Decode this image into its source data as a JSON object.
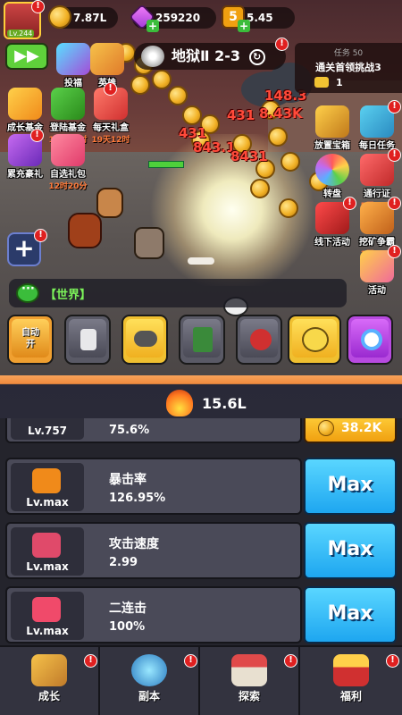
{
  "hud": {
    "player_level": "Lv.244",
    "gold": "7.87L",
    "gems": "259220",
    "energy": "5.45",
    "energy_icon": "5"
  },
  "stage": {
    "title": "地狱Ⅱ 2-3",
    "cycle_icon": "cycle-icon"
  },
  "left_menu": {
    "top_row": [
      {
        "label": "投福"
      },
      {
        "label": "英雄"
      }
    ],
    "row2": [
      {
        "label": "成长基金",
        "sub": ""
      },
      {
        "label": "登陆基金",
        "sub": "19天12时"
      },
      {
        "label": "每天礼盒",
        "sub": "19天12时"
      }
    ],
    "row3": [
      {
        "label": "累充豪礼",
        "sub": ""
      },
      {
        "label": "自选礼包",
        "sub": "12时20分"
      }
    ]
  },
  "quest": {
    "header": "任务 50",
    "title": "通关首领挑战3",
    "count": "1"
  },
  "right_menu": [
    {
      "label": "放置宝箱",
      "sub": ""
    },
    {
      "label": "每日任务",
      "sub": ""
    },
    {
      "label": "转盘",
      "sub": ""
    },
    {
      "label": "通行证",
      "sub": "5天23时"
    },
    {
      "label": "线下活动",
      "sub": ""
    },
    {
      "label": "挖矿争霸",
      "sub": "1天17时"
    },
    {
      "label": "活动",
      "sub": ""
    }
  ],
  "damage_numbers": [
    "431",
    "431",
    "843.1",
    "8431",
    "148.3",
    "8.43K",
    "8431"
  ],
  "chat": {
    "channel": "【世界】"
  },
  "skills": [
    {
      "name": "auto-battle",
      "label": "自动\n开"
    },
    {
      "name": "bottle",
      "label": ""
    },
    {
      "name": "cloud",
      "label": ""
    },
    {
      "name": "fire-card",
      "label": ""
    },
    {
      "name": "bomb",
      "label": ""
    },
    {
      "name": "yellow-face",
      "label": ""
    },
    {
      "name": "gear",
      "label": ""
    }
  ],
  "power": "15.6L",
  "upgrades": [
    {
      "level": "Lv.757",
      "name": "",
      "value": "75.6%",
      "cost": "38.2K",
      "maxed": false
    },
    {
      "level": "Lv.max",
      "name": "暴击率",
      "value": "126.95%",
      "button": "Max",
      "maxed": true
    },
    {
      "level": "Lv.max",
      "name": "攻击速度",
      "value": "2.99",
      "button": "Max",
      "maxed": true
    },
    {
      "level": "Lv.max",
      "name": "二连击",
      "value": "100%",
      "button": "Max",
      "maxed": true
    }
  ],
  "nav": [
    {
      "label": "成长"
    },
    {
      "label": "副本"
    },
    {
      "label": "探索"
    },
    {
      "label": "福利"
    }
  ],
  "colors": {
    "max_button": "#1ea6f0",
    "cost_button": "#f0a010",
    "alert": "#e02020",
    "chat_text": "#7cf35a"
  }
}
